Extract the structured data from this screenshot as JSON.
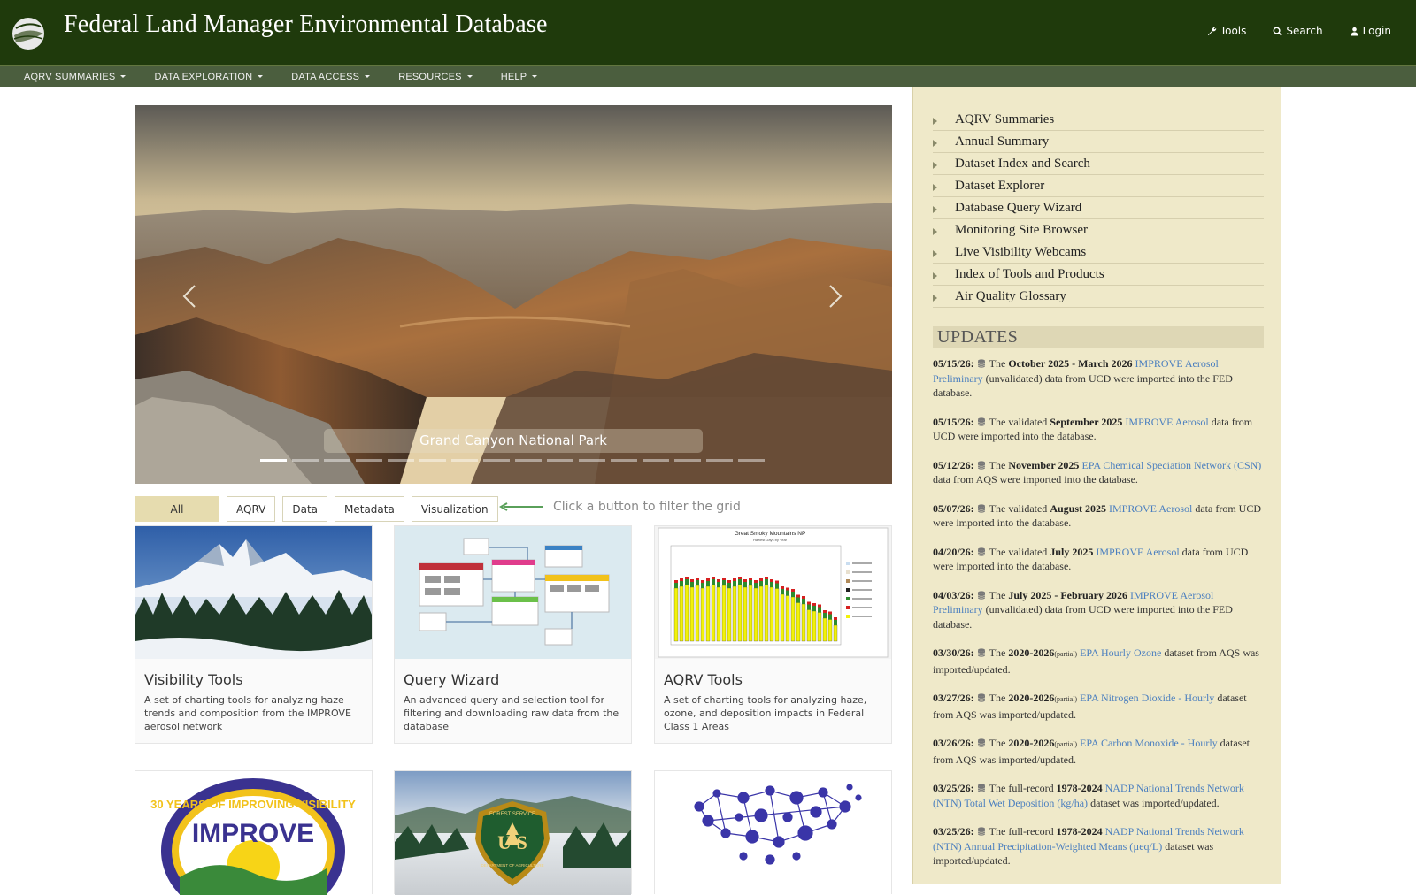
{
  "header": {
    "title": "Federal Land Manager Environmental Database",
    "links": [
      {
        "label": "Tools",
        "icon": "wrench-icon"
      },
      {
        "label": "Search",
        "icon": "search-icon"
      },
      {
        "label": "Login",
        "icon": "user-icon"
      }
    ]
  },
  "nav": [
    {
      "label": "AQRV SUMMARIES"
    },
    {
      "label": "DATA EXPLORATION"
    },
    {
      "label": "DATA ACCESS"
    },
    {
      "label": "RESOURCES"
    },
    {
      "label": "HELP"
    }
  ],
  "carousel": {
    "caption": "Grand Canyon National Park",
    "slide_count": 16,
    "active_index": 0
  },
  "filters": {
    "buttons": [
      "All",
      "AQRV",
      "Data",
      "Metadata",
      "Visualization"
    ],
    "active": "All",
    "hint": "Click a button to filter the grid"
  },
  "cards": [
    {
      "title": "Visibility Tools",
      "desc": "A set of charting tools for analyzing haze trends and composition from the IMPROVE aerosol network"
    },
    {
      "title": "Query Wizard",
      "desc": "An advanced query and selection tool for filtering and downloading raw data from the database"
    },
    {
      "title": "AQRV Tools",
      "desc": "A set of charting tools for analyzing haze, ozone, and deposition impacts in Federal Class 1 Areas",
      "chart_title": "Great Smoky Mountains NP",
      "chart_subtitle": "Haziest Days by Year"
    }
  ],
  "sidebar": {
    "menu": [
      "AQRV Summaries",
      "Annual Summary",
      "Dataset Index and Search",
      "Dataset Explorer",
      "Database Query Wizard",
      "Monitoring Site Browser",
      "Live Visibility Webcams",
      "Index of Tools and Products",
      "Air Quality Glossary"
    ],
    "updates_title": "UPDATES",
    "updates": [
      {
        "date": "05/15/26:",
        "pre": "The",
        "period": "October 2025 - March 2026",
        "partial": "",
        "link": "IMPROVE Aerosol Preliminary",
        "post": "(unvalidated) data from UCD were imported into the FED database."
      },
      {
        "date": "05/15/26:",
        "pre": "The validated",
        "period": "September 2025",
        "partial": "",
        "link": "IMPROVE Aerosol",
        "post": "data from UCD were imported into the database."
      },
      {
        "date": "05/12/26:",
        "pre": "The",
        "period": "November 2025",
        "partial": "",
        "link": "EPA Chemical Speciation Network (CSN)",
        "post": "data from AQS were imported into the database."
      },
      {
        "date": "05/07/26:",
        "pre": "The validated",
        "period": "August 2025",
        "partial": "",
        "link": "IMPROVE Aerosol",
        "post": "data from UCD were imported into the database."
      },
      {
        "date": "04/20/26:",
        "pre": "The validated",
        "period": "July 2025",
        "partial": "",
        "link": "IMPROVE Aerosol",
        "post": "data from UCD were imported into the database."
      },
      {
        "date": "04/03/26:",
        "pre": "The",
        "period": "July 2025 - February 2026",
        "partial": "",
        "link": "IMPROVE Aerosol Preliminary",
        "post": "(unvalidated) data from UCD were imported into the FED database."
      },
      {
        "date": "03/30/26:",
        "pre": "The",
        "period": "2020-2026",
        "partial": "(partial)",
        "link": "EPA Hourly Ozone",
        "post": "dataset from AQS was imported/updated."
      },
      {
        "date": "03/27/26:",
        "pre": "The",
        "period": "2020-2026",
        "partial": "(partial)",
        "link": "EPA Nitrogen Dioxide - Hourly",
        "post": "dataset from AQS was imported/updated."
      },
      {
        "date": "03/26/26:",
        "pre": "The",
        "period": "2020-2026",
        "partial": "(partial)",
        "link": "EPA Carbon Monoxide - Hourly",
        "post": "dataset from AQS was imported/updated."
      },
      {
        "date": "03/25/26:",
        "pre": "The full-record",
        "period": "1978-2024",
        "partial": "",
        "link": "NADP National Trends Network (NTN) Total Wet Deposition (kg/ha)",
        "post": "dataset was imported/updated."
      },
      {
        "date": "03/25/26:",
        "pre": "The full-record",
        "period": "1978-2024",
        "partial": "",
        "link": "NADP National Trends Network (NTN) Annual Precipitation-Weighted Means (µeq/L)",
        "post": "dataset was imported/updated."
      }
    ]
  },
  "logos": {
    "improve_text": "30 YEARS OF IMPROVING VISIBILITY",
    "improve_name": "IMPROVE",
    "forest_service_top": "FOREST SERVICE",
    "forest_service_bottom": "DEPARTMENT OF AGRICULTURE",
    "forest_service_letters": "U S"
  },
  "colors": {
    "header_bg": "#1f3a0c",
    "nav_bg": "#4b5e3e",
    "sidebar_bg": "#efe9c9",
    "link": "#4b7fbf",
    "filter_active": "#e6dcaf"
  }
}
